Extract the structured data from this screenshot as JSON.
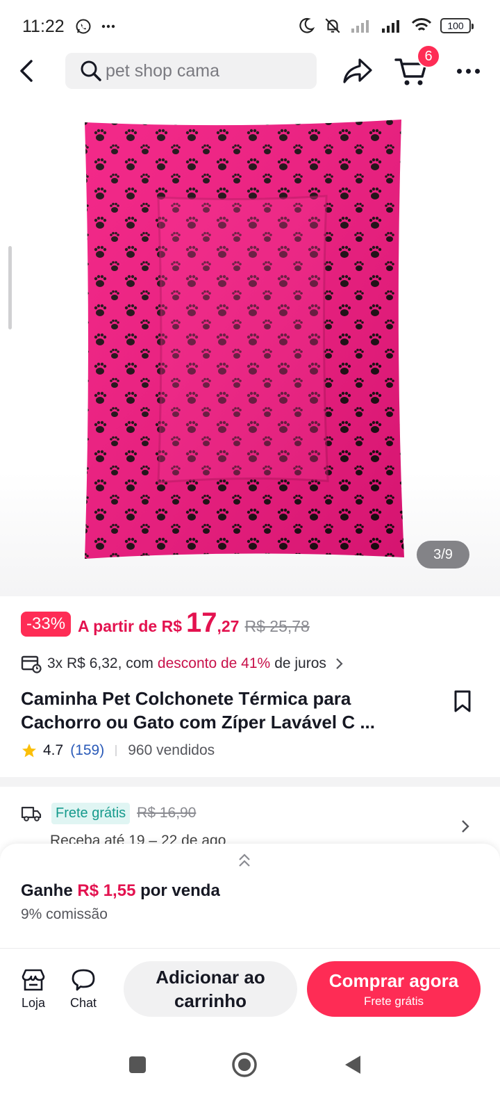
{
  "status_bar": {
    "time": "11:22",
    "battery": "100"
  },
  "header": {
    "search_text": "pet shop cama",
    "cart_count": "6"
  },
  "product": {
    "image_counter": "3/9",
    "discount": "-33%",
    "price_prefix": "A partir de R$",
    "price_int": "17",
    "price_dec": ",27",
    "price_old": "R$ 25,78",
    "installment_prefix": "3x R$ 6,32, com",
    "installment_accent": "desconto de 41%",
    "installment_suffix": "de juros",
    "title_line1": "Caminha Pet Colchonete Térmica para",
    "title_line2": "Cachorro ou Gato com Zíper Lavável C ...",
    "rating": "4.7",
    "rating_count": "(159)",
    "sold": "960 vendidos",
    "image_colors": {
      "fabric": "#f2177f",
      "paw": "#1a0a10"
    }
  },
  "shipping": {
    "free_label": "Frete grátis",
    "old_price": "R$ 16,90",
    "delivery": "Receba até 19 – 22 de ago"
  },
  "commission": {
    "earn_prefix": "Ganhe",
    "earn_value": "R$ 1,55",
    "earn_suffix": "por venda",
    "percent": "9% comissão"
  },
  "actions": {
    "store_label": "Loja",
    "chat_label": "Chat",
    "add_cart_line1": "Adicionar ao",
    "add_cart_line2": "carrinho",
    "buy_label": "Comprar agora",
    "buy_sub": "Frete grátis"
  },
  "colors": {
    "accent": "#fe2c55",
    "price": "#e3124f",
    "teal": "#159a8c"
  }
}
